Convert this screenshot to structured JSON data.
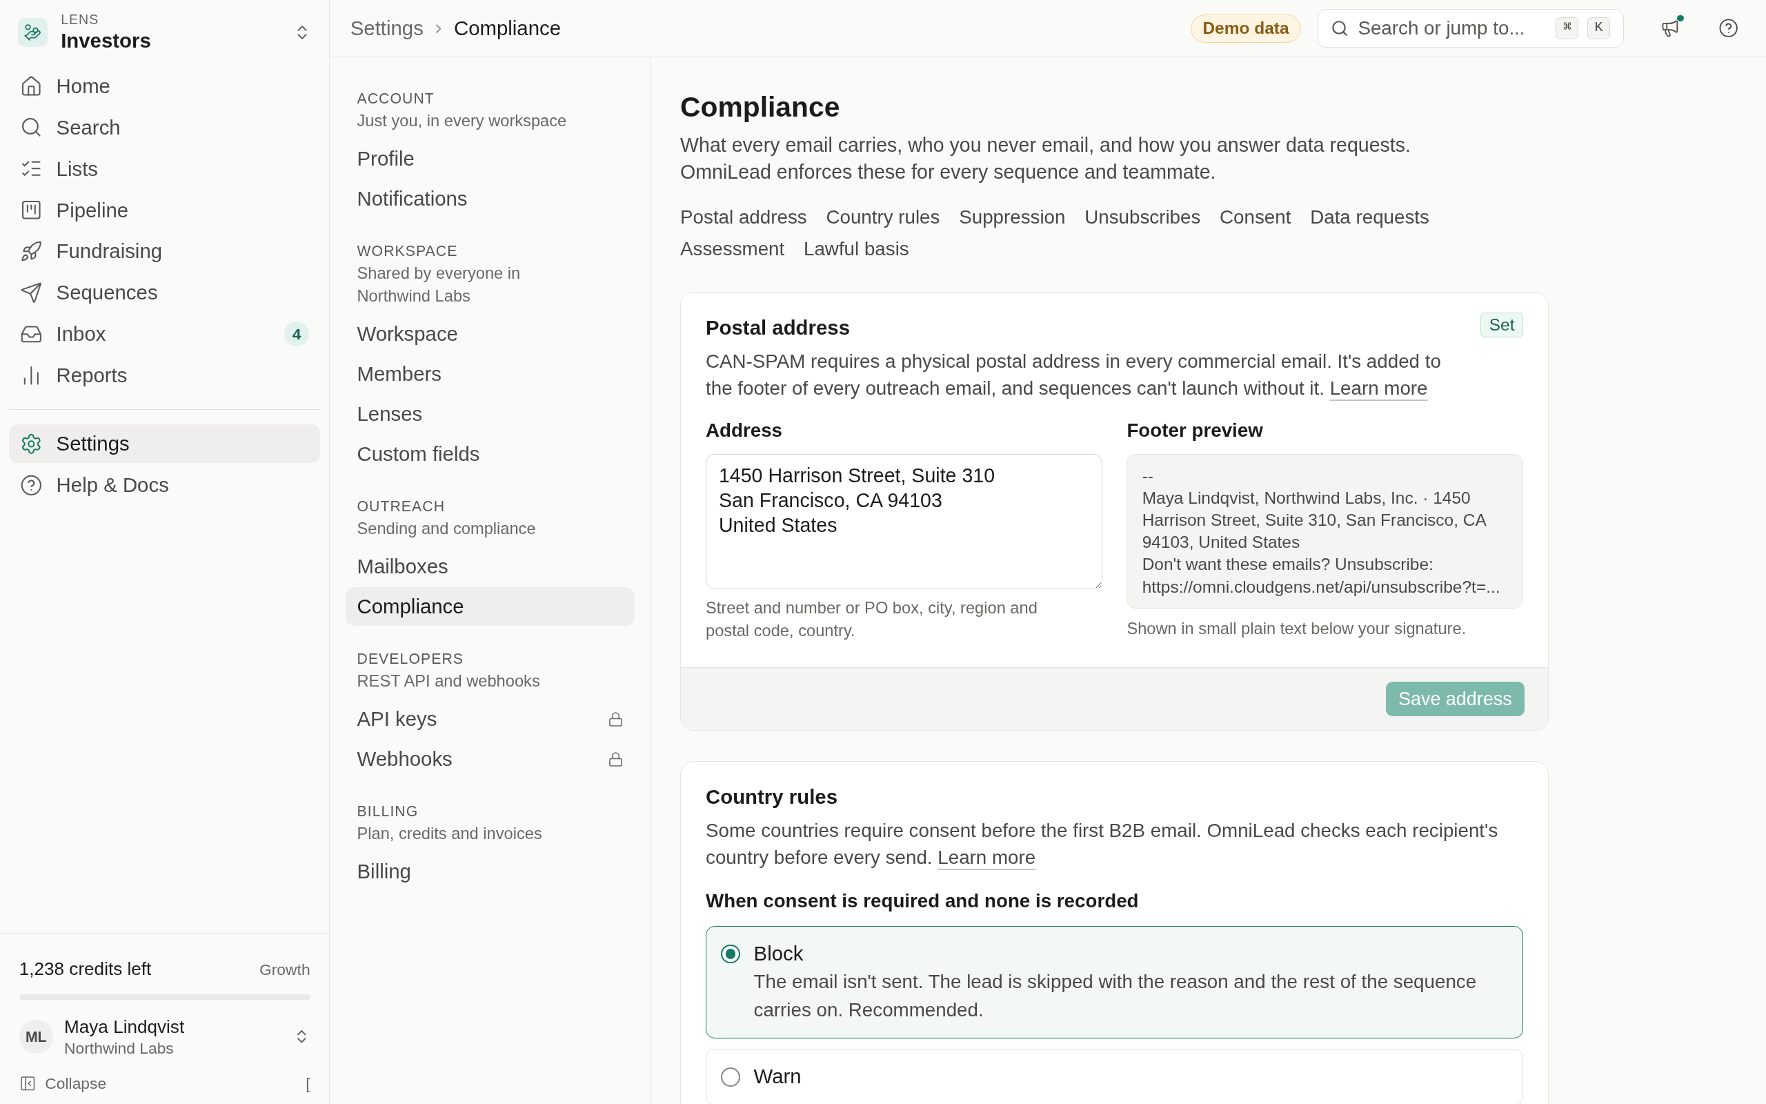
{
  "workspace": {
    "label": "LENS",
    "name": "Investors"
  },
  "nav": [
    {
      "label": "Home",
      "kind": "home",
      "selected": false
    },
    {
      "label": "Search",
      "kind": "search",
      "selected": false
    },
    {
      "label": "Lists",
      "kind": "lists",
      "selected": false
    },
    {
      "label": "Pipeline",
      "kind": "pipeline",
      "selected": false
    },
    {
      "label": "Fundraising",
      "kind": "rocket",
      "selected": false
    },
    {
      "label": "Sequences",
      "kind": "send",
      "selected": false
    },
    {
      "label": "Inbox",
      "kind": "inbox",
      "selected": false,
      "badge": "4"
    },
    {
      "label": "Reports",
      "kind": "chart",
      "selected": false
    }
  ],
  "nav_bottom": [
    {
      "label": "Settings",
      "kind": "settings",
      "selected": true
    },
    {
      "label": "Help & Docs",
      "kind": "help",
      "selected": false
    }
  ],
  "credits": {
    "text": "1,238 credits left",
    "plan": "Growth"
  },
  "user": {
    "initials": "ML",
    "name": "Maya Lindqvist",
    "org": "Northwind Labs"
  },
  "collapse": {
    "label": "Collapse",
    "shortcut": "["
  },
  "breadcrumb": [
    "Settings",
    "Compliance"
  ],
  "topbar": {
    "badge": "Demo data",
    "search_placeholder": "Search or jump to...",
    "keys": [
      "⌘",
      "K"
    ]
  },
  "settings_nav": [
    {
      "title": "ACCOUNT",
      "subtitle": "Just you, in every workspace",
      "items": [
        {
          "label": "Profile",
          "selected": false,
          "locked": false
        },
        {
          "label": "Notifications",
          "selected": false,
          "locked": false
        }
      ]
    },
    {
      "title": "WORKSPACE",
      "subtitle": "Shared by everyone in Northwind Labs",
      "items": [
        {
          "label": "Workspace",
          "selected": false,
          "locked": false
        },
        {
          "label": "Members",
          "selected": false,
          "locked": false
        },
        {
          "label": "Lenses",
          "selected": false,
          "locked": false
        },
        {
          "label": "Custom fields",
          "selected": false,
          "locked": false
        }
      ]
    },
    {
      "title": "OUTREACH",
      "subtitle": "Sending and compliance",
      "items": [
        {
          "label": "Mailboxes",
          "selected": false,
          "locked": false
        },
        {
          "label": "Compliance",
          "selected": true,
          "locked": false
        }
      ]
    },
    {
      "title": "DEVELOPERS",
      "subtitle": "REST API and webhooks",
      "items": [
        {
          "label": "API keys",
          "selected": false,
          "locked": true
        },
        {
          "label": "Webhooks",
          "selected": false,
          "locked": true
        }
      ]
    },
    {
      "title": "BILLING",
      "subtitle": "Plan, credits and invoices",
      "items": [
        {
          "label": "Billing",
          "selected": false,
          "locked": false
        }
      ]
    }
  ],
  "page": {
    "title": "Compliance",
    "description": "What every email carries, who you never email, and how you answer data requests. OmniLead enforces these for every sequence and teammate.",
    "sections": [
      "Postal address",
      "Country rules",
      "Suppression",
      "Unsubscribes",
      "Consent",
      "Data requests",
      "Assessment",
      "Lawful basis"
    ]
  },
  "postal": {
    "title": "Postal address",
    "status": "Set",
    "description": "CAN-SPAM requires a physical postal address in every commercial email. It's added to the footer of every outreach email, and sequences can't launch without it.",
    "link": "Learn more",
    "address_label": "Address",
    "address_value": "1450 Harrison Street, Suite 310\nSan Francisco, CA 94103\nUnited States",
    "address_hint": "Street and number or PO box, city, region and postal code, country.",
    "preview_label": "Footer preview",
    "preview_lines": [
      "--",
      "Maya Lindqvist, Northwind Labs, Inc. · 1450 Harrison Street, Suite 310, San Francisco, CA 94103, United States",
      "Don't want these emails? Unsubscribe: https://omni.cloudgens.net/api/unsubscribe?t=..."
    ],
    "preview_hint": "Shown in small plain text below your signature.",
    "save": "Save address",
    "save_disabled": true
  },
  "country": {
    "title": "Country rules",
    "description": "Some countries require consent before the first B2B email. OmniLead checks each recipient's country before every send.",
    "link": "Learn more",
    "question": "When consent is required and none is recorded",
    "options": [
      {
        "label": "Block",
        "description": "The email isn't sent. The lead is skipped with the reason and the rest of the sequence carries on. Recommended.",
        "selected": true
      },
      {
        "label": "Warn",
        "selected": false
      }
    ]
  }
}
